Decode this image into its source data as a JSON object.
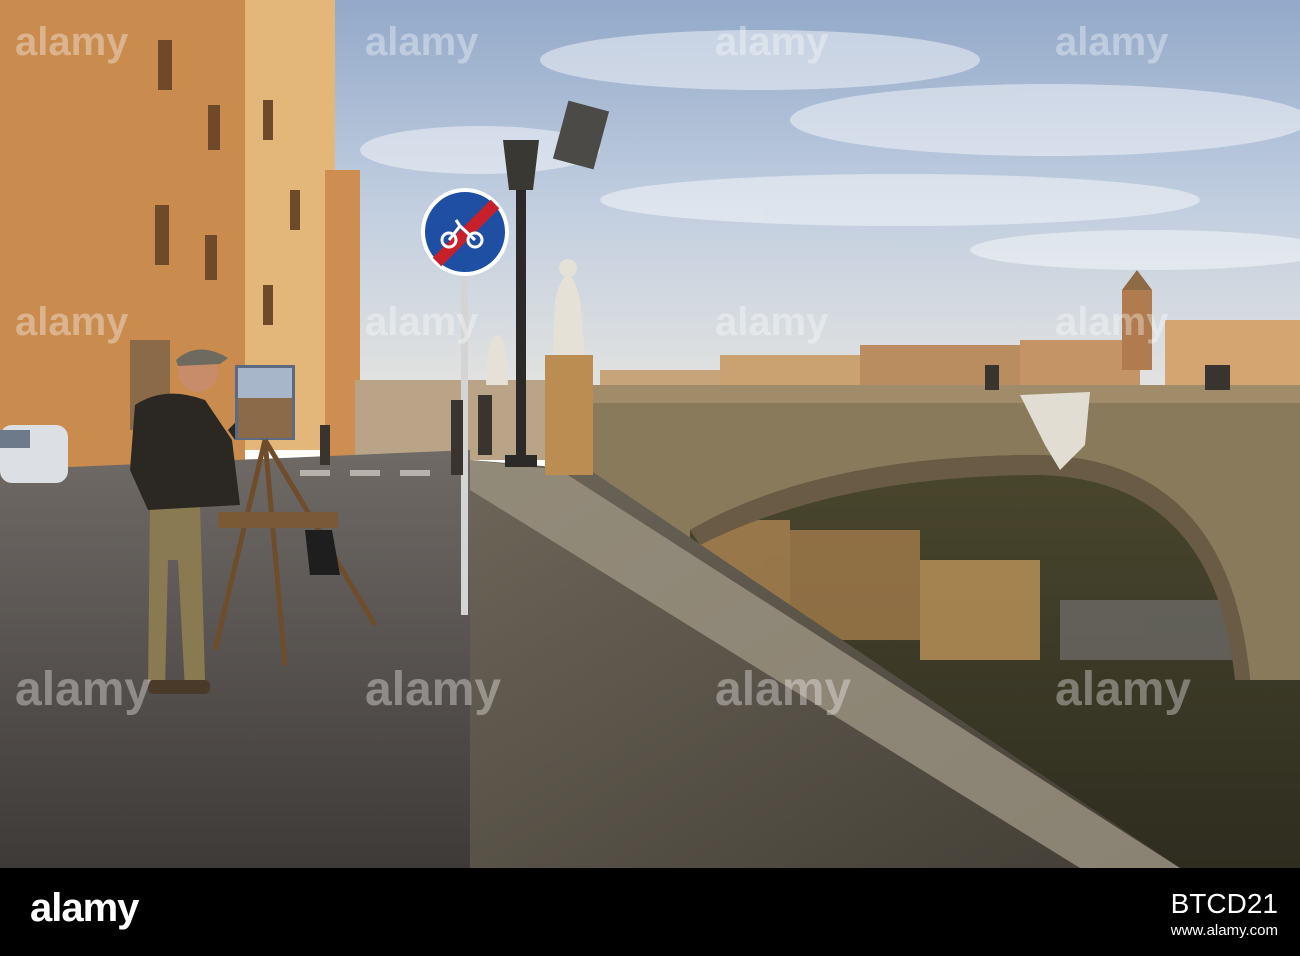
{
  "watermark": {
    "text": "alamy"
  },
  "footer": {
    "logo": "alamy",
    "image_id": "BTCD21",
    "url": "www.alamy.com"
  },
  "colors": {
    "sky": "#b7c7dd",
    "buildings": "#c98b4e",
    "river": "#3a3a28",
    "footer": "#000000"
  }
}
